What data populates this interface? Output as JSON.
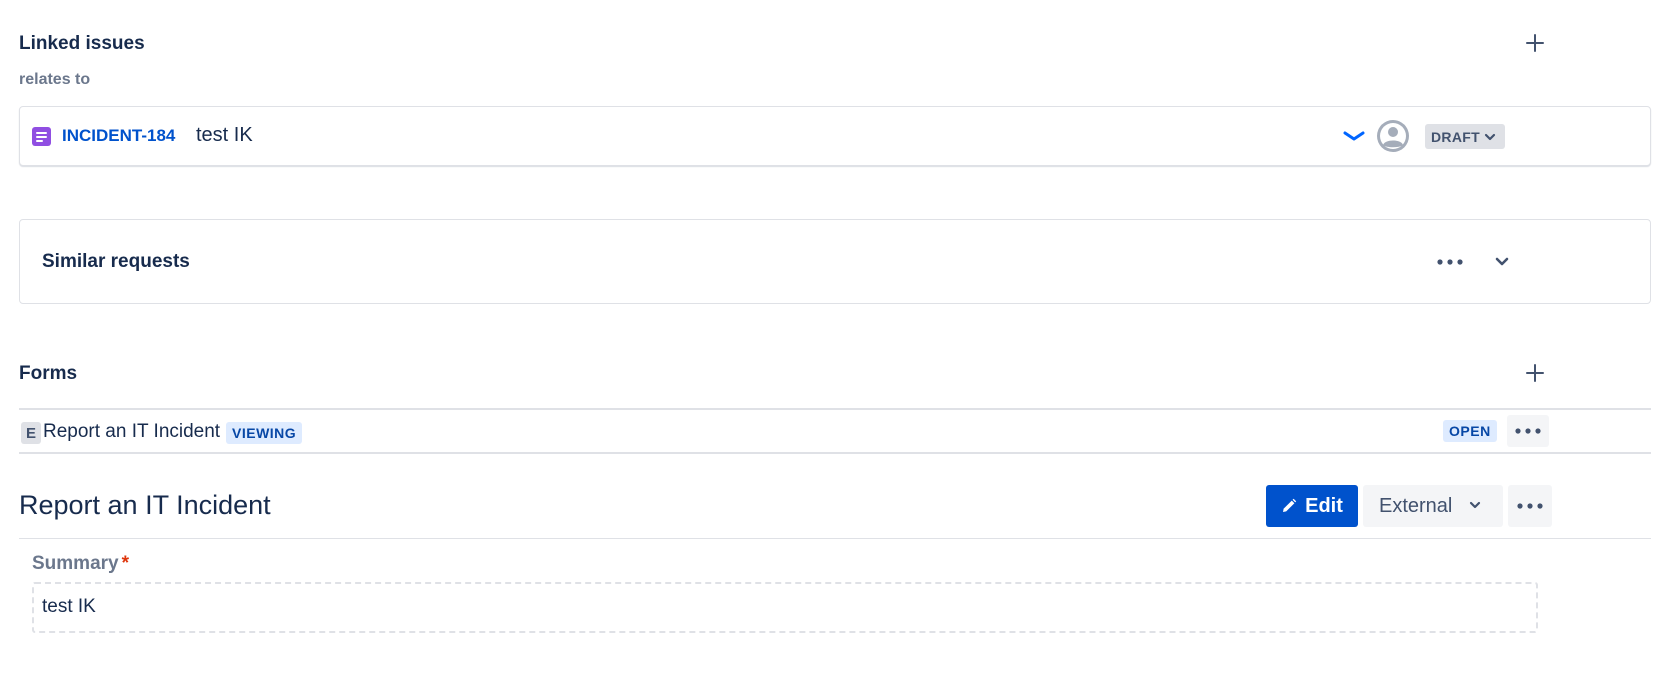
{
  "linked_issues": {
    "title": "Linked issues",
    "relation": "relates to",
    "items": [
      {
        "key": "INCIDENT-184",
        "summary": "test IK",
        "priority_icon": "chevron-priority-low-icon",
        "assignee_icon": "unassigned-avatar-icon",
        "status": "DRAFT"
      }
    ]
  },
  "similar_requests": {
    "title": "Similar requests"
  },
  "forms": {
    "title": "Forms",
    "items": [
      {
        "badge": "E",
        "name": "Report an IT Incident",
        "viewing_label": "VIEWING",
        "status": "OPEN"
      }
    ]
  },
  "form_detail": {
    "title": "Report an IT Incident",
    "edit_label": "Edit",
    "visibility_label": "External",
    "fields": [
      {
        "label": "Summary",
        "required_mark": "*",
        "value": "test IK"
      }
    ]
  },
  "colors": {
    "primary": "#0052cc",
    "text": "#172b4d",
    "subtle_text": "#6b778c",
    "issue_type": "#904ee2",
    "lozenge_blue_bg": "#deebff",
    "lozenge_blue_text": "#0747a6",
    "required": "#de350b"
  }
}
